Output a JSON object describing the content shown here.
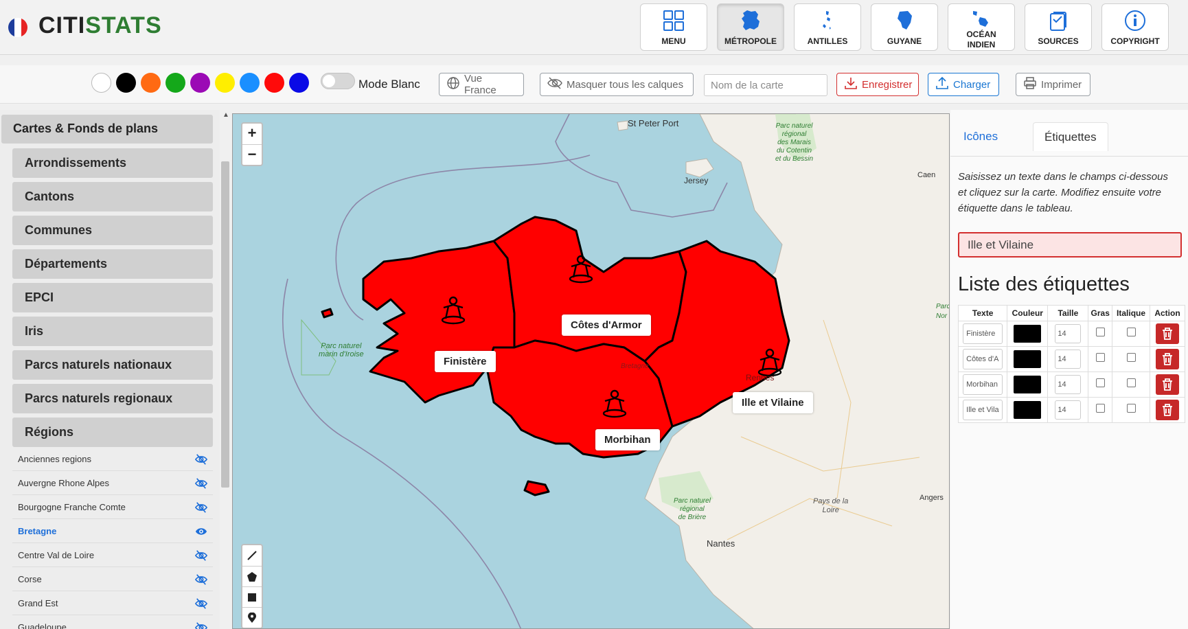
{
  "app": {
    "name_part1": "CITI",
    "name_part2": "STATS"
  },
  "nav": [
    {
      "id": "menu",
      "label": "MENU",
      "icon": "grid-icon"
    },
    {
      "id": "metropole",
      "label": "MÉTROPOLE",
      "icon": "france-map-icon",
      "active": true
    },
    {
      "id": "antilles",
      "label": "ANTILLES",
      "icon": "antilles-map-icon"
    },
    {
      "id": "guyane",
      "label": "GUYANE",
      "icon": "guyane-map-icon"
    },
    {
      "id": "ocean",
      "label1": "OCÉAN",
      "label2": "INDIEN",
      "icon": "ocean-indien-map-icon"
    },
    {
      "id": "sources",
      "label": "SOURCES",
      "icon": "document-icon"
    },
    {
      "id": "copyright",
      "label": "COPYRIGHT",
      "icon": "info-icon"
    }
  ],
  "toolbar": {
    "colors": [
      "#ffffff",
      "#000000",
      "#ff6a13",
      "#14a81a",
      "#9b0ab5",
      "#ffee00",
      "#1a8fff",
      "#ff0a0a",
      "#0a0ae6"
    ],
    "mode_blanc": "Mode Blanc",
    "vue_france": "Vue France",
    "masquer": "Masquer tous les calques",
    "map_name_placeholder": "Nom de la carte",
    "enregistrer": "Enregistrer",
    "charger": "Charger",
    "imprimer": "Imprimer"
  },
  "sidebar": {
    "header": "Cartes & Fonds de plans",
    "categories": [
      "Arrondissements",
      "Cantons",
      "Communes",
      "Départements",
      "EPCI",
      "Iris",
      "Parcs naturels nationaux",
      "Parcs naturels regionaux",
      "Régions"
    ],
    "regions": [
      {
        "label": "Anciennes regions",
        "visible": false
      },
      {
        "label": "Auvergne Rhone Alpes",
        "visible": false
      },
      {
        "label": "Bourgogne Franche Comte",
        "visible": false
      },
      {
        "label": "Bretagne",
        "visible": true
      },
      {
        "label": "Centre Val de Loire",
        "visible": false
      },
      {
        "label": "Corse",
        "visible": false
      },
      {
        "label": "Grand Est",
        "visible": false
      },
      {
        "label": "Guadeloupe",
        "visible": false
      }
    ]
  },
  "map": {
    "zoom_in": "+",
    "zoom_out": "−",
    "fill_color": "#ff0000",
    "labels": [
      "Finistère",
      "Côtes d'Armor",
      "Morbihan",
      "Ille et Vilaine"
    ],
    "places": {
      "st_peter_port": "St Peter Port",
      "jersey": "Jersey",
      "caen": "Caen",
      "nantes": "Nantes",
      "angers": "Angers",
      "rennes": "Rennes",
      "bretagne": "Bretagne",
      "iroise_1": "Parc naturel",
      "iroise_2": "marin d'Iroise",
      "cotentin_1": "Parc naturel",
      "cotentin_2": "régional",
      "cotentin_3": "des Marais",
      "cotentin_4": "du Cotentin",
      "cotentin_5": "et du Bessin",
      "briere_1": "Parc naturel",
      "briere_2": "régional",
      "briere_3": "de Brière",
      "pays_loire_1": "Pays de la",
      "pays_loire_2": "Loire",
      "right_edge_1": "Parc",
      "right_edge_2": "Nor"
    }
  },
  "panel": {
    "tab_icons": "Icônes",
    "tab_labels": "Étiquettes",
    "hint": "Saisissez un texte dans le champs ci-dessous et cliquez sur la carte. Modifiez ensuite votre étiquette dans le tableau.",
    "input_value": "Ille et Vilaine",
    "list_title": "Liste des étiquettes",
    "columns": [
      "Texte",
      "Couleur",
      "Taille",
      "Gras",
      "Italique",
      "Action"
    ],
    "rows": [
      {
        "text": "Finistère",
        "color": "#000000",
        "size": "14"
      },
      {
        "text": "Côtes d'Armor",
        "color": "#000000",
        "size": "14"
      },
      {
        "text": "Morbihan",
        "color": "#000000",
        "size": "14"
      },
      {
        "text": "Ille et Vilaine",
        "color": "#000000",
        "size": "14"
      }
    ]
  }
}
